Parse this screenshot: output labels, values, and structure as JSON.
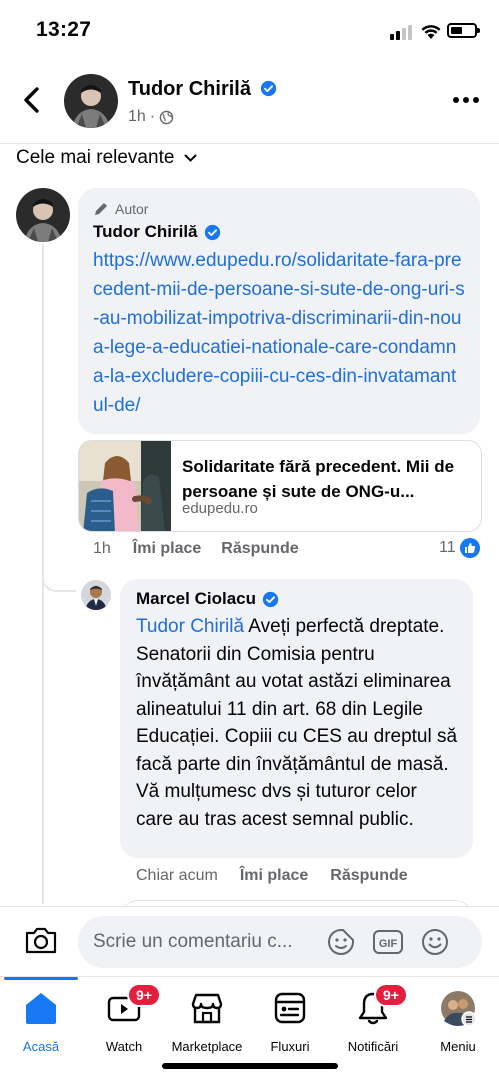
{
  "status_bar": {
    "time": "13:27"
  },
  "header": {
    "name": "Tudor Chirilă",
    "meta_time": "1h",
    "meta_sep": "·"
  },
  "sort": {
    "label": "Cele mai relevante"
  },
  "comment_author": {
    "author_tag": "Autor",
    "name": "Tudor Chirilă",
    "link": "https://www.edupedu.ro/solidaritate-fara-precedent-mii-de-persoane-si-sute-de-ong-uri-s-au-mobilizat-impotriva-discriminarii-din-noua-lege-a-educatiei-nationale-care-condamna-la-excludere-copiii-cu-ces-din-invatamantul-de/",
    "card": {
      "title": "Solidaritate fără precedent. Mii de persoane și sute de ONG-u...",
      "domain": "edupedu.ro"
    },
    "actions": {
      "time": "1h",
      "like": "Îmi place",
      "reply": "Răspunde",
      "like_count": "11"
    }
  },
  "comment_reply": {
    "name": "Marcel Ciolacu",
    "mention": "Tudor Chirilă",
    "text": " Aveți perfectă dreptate. Senatorii din Comisia pentru învățământ au votat astăzi eliminarea alineatului 11 din art. 68 din Legile Educației. Copiii cu CES au dreptul să facă parte din învățământul de masă. Vă mulțumesc dvs și tuturor celor care au tras acest semnal public.",
    "actions": {
      "time": "Chiar acum",
      "like": "Îmi place",
      "reply": "Răspunde"
    }
  },
  "composer": {
    "placeholder": "Scrie un comentariu c..."
  },
  "tabs": [
    {
      "label": "Acasă",
      "icon": "home-icon",
      "active": true
    },
    {
      "label": "Watch",
      "icon": "watch-icon",
      "badge": "9+"
    },
    {
      "label": "Marketplace",
      "icon": "marketplace-icon"
    },
    {
      "label": "Fluxuri",
      "icon": "feeds-icon"
    },
    {
      "label": "Notificări",
      "icon": "bell-icon",
      "badge": "9+"
    },
    {
      "label": "Meniu",
      "icon": "profile-menu-icon"
    }
  ],
  "colors": {
    "accent": "#1877f2",
    "link": "#216fdb",
    "badge": "#e41e3f",
    "bubble": "#f0f2f5"
  }
}
